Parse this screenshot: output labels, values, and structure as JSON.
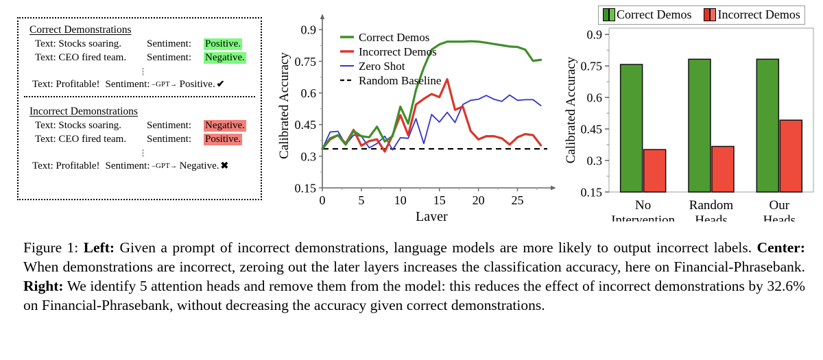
{
  "left_panel": {
    "correct": {
      "heading": "Correct Demonstrations",
      "rows": [
        {
          "text": "Text: Stocks soaring.",
          "sentiment_label": "Sentiment:",
          "value": "Positive.",
          "highlight": "green"
        },
        {
          "text": "Text: CEO fired team.",
          "sentiment_label": "Sentiment:",
          "value": "Negative.",
          "highlight": "green"
        }
      ],
      "ellipsis": "⋮",
      "final": {
        "text": "Text: Profitable!",
        "sentiment_label": "Sentiment:",
        "arrow": "–GPT→",
        "value": "Positive.",
        "mark": "✔"
      }
    },
    "incorrect": {
      "heading": "Incorrect Demonstrations",
      "rows": [
        {
          "text": "Text: Stocks soaring.",
          "sentiment_label": "Sentiment:",
          "value": "Negative.",
          "highlight": "red"
        },
        {
          "text": "Text: CEO fired team.",
          "sentiment_label": "Sentiment:",
          "value": "Positive.",
          "highlight": "red"
        }
      ],
      "ellipsis": "⋮",
      "final": {
        "text": "Text: Profitable!",
        "sentiment_label": "Sentiment:",
        "arrow": "–GPT→",
        "value": "Negative.",
        "mark": "✖"
      }
    },
    "colors": {
      "green_highlight": "#7dfa7d",
      "red_highlight": "#f4807a"
    }
  },
  "chart_data": [
    {
      "id": "center-line-chart",
      "type": "line",
      "title": "",
      "xlabel": "Layer",
      "ylabel": "Calibrated Accuracy",
      "xlim": [
        0,
        29
      ],
      "ylim": [
        0.15,
        0.93
      ],
      "xticks": [
        0,
        5,
        10,
        15,
        20,
        25
      ],
      "yticks": [
        0.15,
        0.3,
        0.45,
        0.6,
        0.75,
        0.9
      ],
      "ytick_labels": [
        "0.15",
        "0.3",
        "0.45",
        "0.6",
        "0.75",
        "0.9"
      ],
      "grid": false,
      "legend_position": "top-left",
      "x": [
        0,
        1,
        2,
        3,
        4,
        5,
        6,
        7,
        8,
        9,
        10,
        11,
        12,
        13,
        14,
        15,
        16,
        17,
        18,
        19,
        20,
        21,
        22,
        23,
        24,
        25,
        26,
        27,
        28
      ],
      "series": [
        {
          "name": "Correct Demos",
          "color": "#3f8f29",
          "style": "solid",
          "values": [
            0.335,
            0.385,
            0.4,
            0.355,
            0.42,
            0.395,
            0.39,
            0.44,
            0.37,
            0.395,
            0.535,
            0.455,
            0.615,
            0.72,
            0.805,
            0.83,
            0.843,
            0.843,
            0.843,
            0.845,
            0.843,
            0.838,
            0.832,
            0.826,
            0.82,
            0.818,
            0.805,
            0.752,
            0.757
          ]
        },
        {
          "name": "Incorrect Demos",
          "color": "#d9362b",
          "style": "solid",
          "values": [
            0.335,
            0.38,
            0.4,
            0.36,
            0.425,
            0.35,
            0.372,
            0.38,
            0.322,
            0.4,
            0.495,
            0.4,
            0.545,
            0.572,
            0.595,
            0.58,
            0.665,
            0.52,
            0.535,
            0.42,
            0.38,
            0.395,
            0.395,
            0.385,
            0.355,
            0.39,
            0.405,
            0.4,
            0.352
          ]
        },
        {
          "name": "Zero Shot",
          "color": "#3333cc",
          "style": "solid",
          "values": [
            0.335,
            0.415,
            0.418,
            0.355,
            0.4,
            0.395,
            0.34,
            0.36,
            0.395,
            0.33,
            0.388,
            0.385,
            0.478,
            0.36,
            0.498,
            0.462,
            0.508,
            0.46,
            0.545,
            0.565,
            0.57,
            0.588,
            0.57,
            0.56,
            0.59,
            0.565,
            0.568,
            0.568,
            0.54
          ]
        },
        {
          "name": "Random Baseline",
          "color": "#000000",
          "style": "dashed",
          "constant": 0.335
        }
      ]
    },
    {
      "id": "right-bar-chart",
      "type": "bar",
      "title": "",
      "xlabel": "",
      "ylabel": "Calibrated Accuracy",
      "ylim": [
        0.15,
        0.93
      ],
      "yticks": [
        0.15,
        0.3,
        0.45,
        0.6,
        0.75,
        0.9
      ],
      "ytick_labels": [
        "0.15",
        "0.3",
        "0.45",
        "0.6",
        "0.75",
        "0.9"
      ],
      "grid": false,
      "legend_position": "top",
      "categories": [
        "No Intervention",
        "Random Heads",
        "Our Heads"
      ],
      "category_lines": [
        [
          "No",
          "Intervention"
        ],
        [
          "Random",
          "Heads"
        ],
        [
          "Our",
          "Heads"
        ]
      ],
      "series": [
        {
          "name": "Correct Demos",
          "color": "#4e9b32",
          "values": [
            0.757,
            0.782,
            0.782
          ]
        },
        {
          "name": "Incorrect Demos",
          "color": "#ef4b3c",
          "values": [
            0.352,
            0.367,
            0.492
          ]
        }
      ]
    }
  ],
  "caption": {
    "figure_number": "Figure 1:",
    "parts": [
      {
        "bold": true,
        "text": " Left:"
      },
      {
        "bold": false,
        "text": " Given a prompt of incorrect demonstrations, language models are more likely to output incorrect labels."
      },
      {
        "bold": true,
        "text": " Center:"
      },
      {
        "bold": false,
        "text": " When demonstrations are incorrect, zeroing out the later layers increases the classification accuracy, here on Financial-Phrasebank."
      },
      {
        "bold": true,
        "text": " Right:"
      },
      {
        "bold": false,
        "text": " We identify 5 attention heads and remove them from the model: this reduces the effect of incorrect demonstrations by 32.6% on Financial-Phrasebank, without decreasing the accuracy given correct demonstrations."
      }
    ]
  }
}
